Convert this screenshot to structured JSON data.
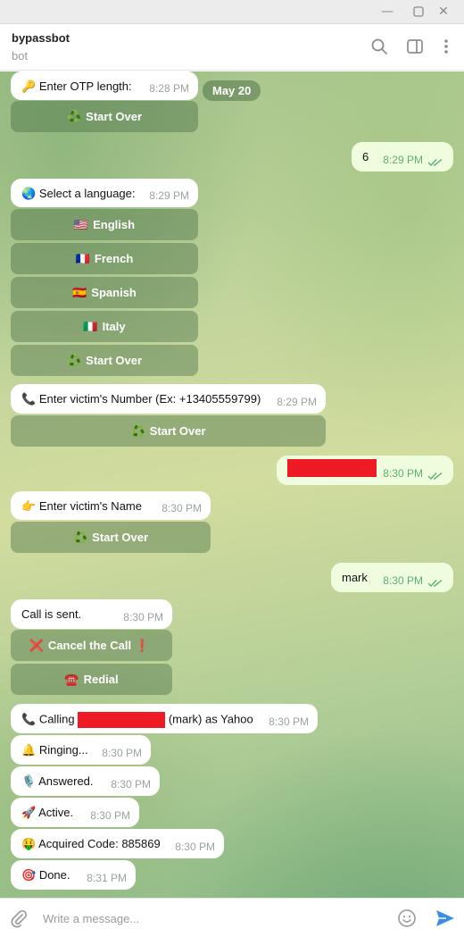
{
  "window": {
    "minimize_icon": "minimize-icon",
    "maximize_icon": "maximize-icon",
    "close_icon": "close-icon"
  },
  "header": {
    "title": "bypassbot",
    "subtitle": "bot",
    "icons": [
      "search-icon",
      "sidebar-toggle-icon",
      "more-vertical-icon"
    ]
  },
  "date_pill": "May 20",
  "messages": [
    {
      "id": "otp-prompt",
      "emoji": "🔑",
      "text": "Enter OTP length:",
      "time": "8:28 PM"
    },
    {
      "id": "otp-answer",
      "text": "6",
      "time": "8:29 PM",
      "outgoing": true
    },
    {
      "id": "lang-prompt",
      "emoji": "🌏",
      "text": "Select a language:",
      "time": "8:29 PM"
    },
    {
      "id": "number-prompt",
      "emoji": "📞",
      "text": "Enter victim's Number (Ex: +13405559799)",
      "time": "8:29 PM"
    },
    {
      "id": "number-answer",
      "text": "",
      "time": "8:30 PM",
      "outgoing": true
    },
    {
      "id": "name-prompt",
      "emoji": "👉",
      "text": "Enter victim's Name",
      "time": "8:30 PM"
    },
    {
      "id": "name-answer",
      "text": "mark",
      "time": "8:30 PM",
      "outgoing": true
    },
    {
      "id": "call-sent",
      "text": "Call is sent.",
      "time": "8:30 PM"
    },
    {
      "id": "calling",
      "emoji": "📞",
      "text_before": "Calling",
      "text_after": "(mark) as Yahoo",
      "time": "8:30 PM"
    },
    {
      "id": "ringing",
      "emoji": "🔔",
      "text": "Ringing...",
      "time": "8:30 PM"
    },
    {
      "id": "answered",
      "emoji": "🎙️",
      "text": "Answered.",
      "time": "8:30 PM"
    },
    {
      "id": "active",
      "emoji": "🚀",
      "text": "Active.",
      "time": "8:30 PM"
    },
    {
      "id": "acquired",
      "emoji": "🤑",
      "text": "Acquired Code: 885869",
      "time": "8:30 PM"
    },
    {
      "id": "done",
      "emoji": "🎯",
      "text": "Done.",
      "time": "8:31 PM"
    }
  ],
  "keyboards": {
    "start_over": {
      "emoji": "♻️",
      "label": "Start Over"
    },
    "english": {
      "emoji": "🇺🇸",
      "label": "English"
    },
    "french": {
      "emoji": "🇫🇷",
      "label": "French"
    },
    "spanish": {
      "emoji": "🇪🇸",
      "label": "Spanish"
    },
    "italy": {
      "emoji": "🇮🇹",
      "label": "Italy"
    },
    "cancel": {
      "emoji": "❌",
      "label": "Cancel the Call",
      "emoji_after": "❗"
    },
    "redial": {
      "emoji": "☎️",
      "label": "Redial"
    }
  },
  "composer": {
    "placeholder": "Write a message...",
    "icons": [
      "attach-icon",
      "emoji-icon",
      "send-icon"
    ]
  },
  "colors": {
    "outgoing_bubble": "#effdde",
    "incoming_bubble": "#ffffff",
    "time_out": "#5bb06e",
    "send": "#3a8ee6",
    "redaction": "#ee1b24"
  }
}
